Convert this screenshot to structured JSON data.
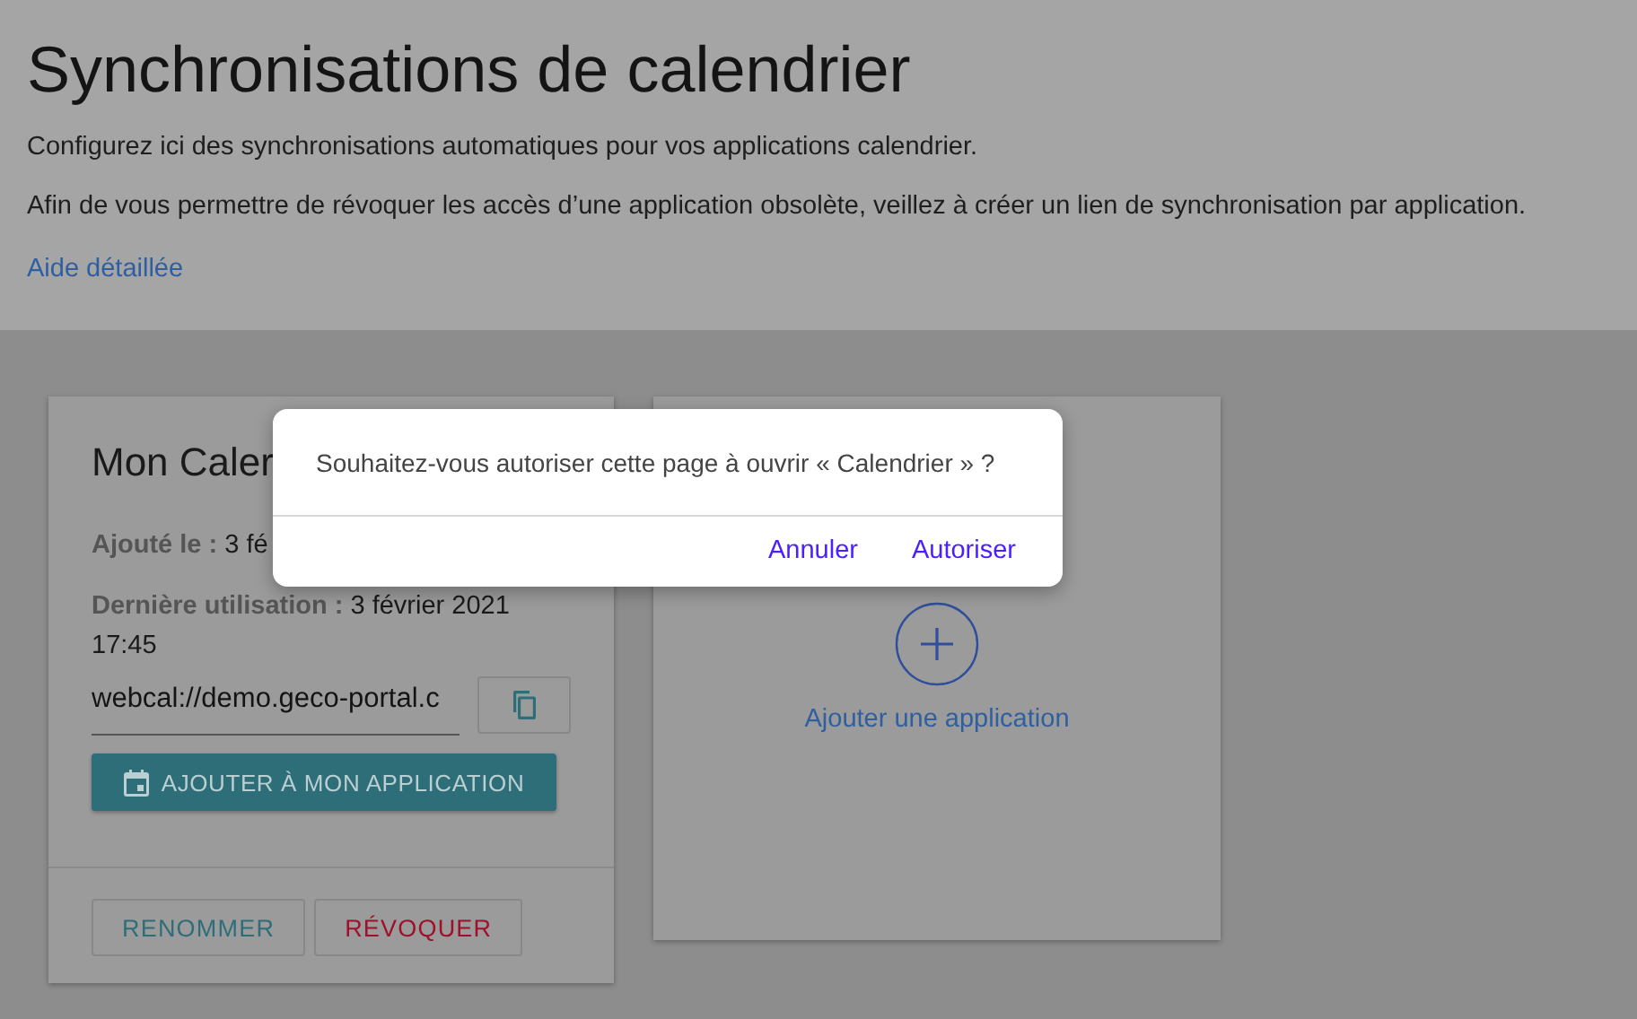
{
  "header": {
    "title": "Synchronisations de calendrier",
    "description": "Configurez ici des synchronisations automatiques pour vos applications calendrier.",
    "note": "Afin de vous permettre de révoquer les accès d’une application obsolète, veillez à créer un lien de synchronisation par application.",
    "help_link": "Aide détaillée"
  },
  "cards": [
    {
      "kind": "calendar",
      "title": "Mon Caler",
      "added": "**Ajouté le :** 3 fé",
      "last_used": "**Dernière utilisation :** 3 février 2021 17:45",
      "url": "webcal://demo.geco-portal.c",
      "add_button": "AJOUTER À MON APPLICATION",
      "actions": [
        {
          "label": "RENOMMER",
          "kind": "neutral"
        },
        {
          "label": "RÉVOQUER",
          "kind": "danger"
        }
      ]
    },
    {
      "kind": "add",
      "label": "Ajouter une application"
    }
  ],
  "dialog": {
    "message": "Souhaitez-vous autoriser cette page à ouvrir « Calendrier » ?",
    "buttons": [
      {
        "label": "Annuler"
      },
      {
        "label": "Autoriser"
      }
    ]
  }
}
